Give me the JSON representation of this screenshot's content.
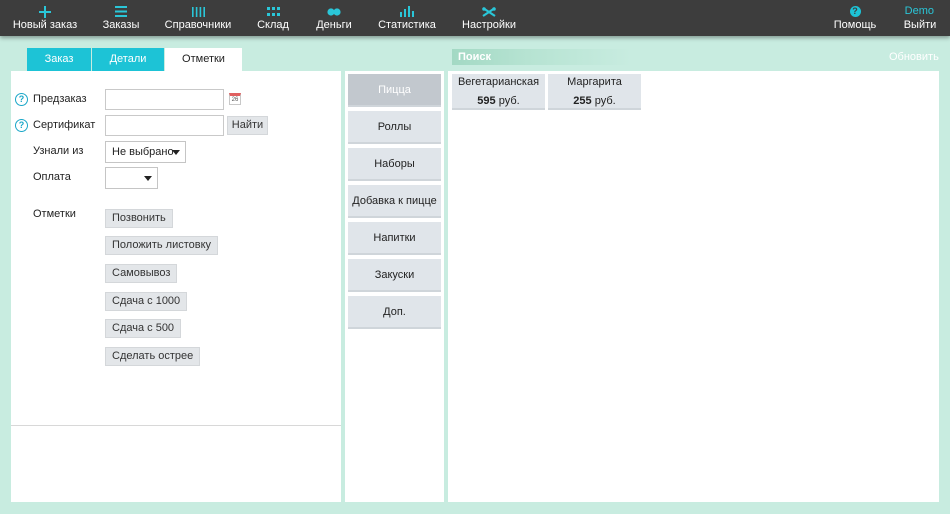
{
  "nav": {
    "items": [
      {
        "label": "Новый заказ",
        "icon": "plus-icon"
      },
      {
        "label": "Заказы",
        "icon": "list-icon"
      },
      {
        "label": "Справочники",
        "icon": "book-icon"
      },
      {
        "label": "Склад",
        "icon": "grid-icon"
      },
      {
        "label": "Деньги",
        "icon": "coins-icon"
      },
      {
        "label": "Статистика",
        "icon": "bar-chart-icon"
      },
      {
        "label": "Настройки",
        "icon": "tools-icon"
      }
    ],
    "help_label": "Помощь",
    "help_icon_glyph": "?",
    "user": "Demo",
    "logout_label": "Выйти",
    "accent_color": "#1dc3d6"
  },
  "tabs": [
    {
      "label": "Заказ"
    },
    {
      "label": "Детали"
    },
    {
      "label": "Отметки"
    }
  ],
  "form": {
    "preorder_label": "Предзаказ",
    "calendar_day": "26",
    "certificate_label": "Сертификат",
    "find_button": "Найти",
    "source_label": "Узнали из",
    "source_value": "Не выбрано",
    "payment_label": "Оплата",
    "payment_value": "",
    "marks_label": "Отметки",
    "marks": [
      "Позвонить",
      "Положить листовку",
      "Самовывоз",
      "Сдача с 1000",
      "Сдача с 500",
      "Сделать острее"
    ]
  },
  "search": {
    "placeholder": "Поиск",
    "refresh_label": "Обновить"
  },
  "categories": [
    "Пицца",
    "Роллы",
    "Наборы",
    "Добавка к пицце",
    "Напитки",
    "Закуски",
    "Доп."
  ],
  "products": [
    {
      "name": "Вегетарианская",
      "price": "595",
      "currency": "руб."
    },
    {
      "name": "Маргарита",
      "price": "255",
      "currency": "руб."
    }
  ]
}
